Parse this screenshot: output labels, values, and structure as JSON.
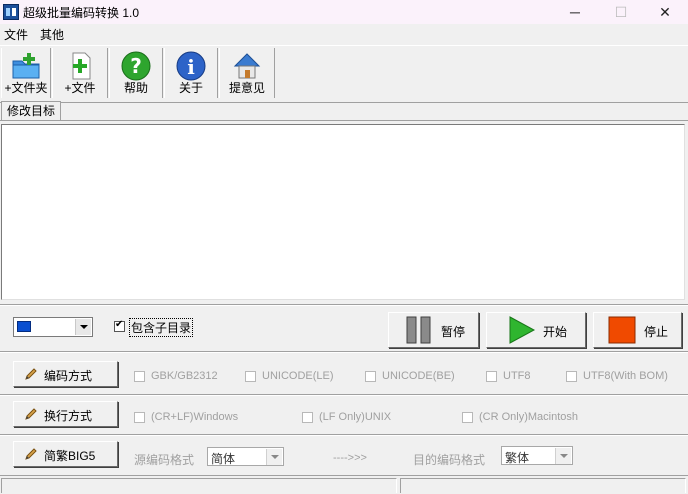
{
  "window": {
    "title": "超级批量编码转换 1.0",
    "minimize_glyph": "─",
    "maximize_glyph": "☐",
    "close_glyph": "✕"
  },
  "menu": {
    "items": [
      "文件",
      "其他"
    ]
  },
  "toolbar": {
    "buttons": [
      {
        "label": "+文件夹",
        "icon": "add-folder-icon"
      },
      {
        "label": "+文件",
        "icon": "add-file-icon"
      },
      {
        "label": "帮助",
        "icon": "help-icon"
      },
      {
        "label": "关于",
        "icon": "info-icon"
      },
      {
        "label": "提意见",
        "icon": "home-feedback-icon"
      }
    ]
  },
  "tabs": {
    "active": "修改目标"
  },
  "controls": {
    "include_subdirs_label": "包含子目录",
    "include_subdirs_checked": true,
    "pause_label": "暂停",
    "start_label": "开始",
    "stop_label": "停止"
  },
  "encoding": {
    "button_label": "编码方式",
    "options": [
      "GBK/GB2312",
      "UNICODE(LE)",
      "UNICODE(BE)",
      "UTF8",
      "UTF8(With BOM)"
    ]
  },
  "linebreak": {
    "button_label": "换行方式",
    "options": [
      "(CR+LF)Windows",
      "(LF Only)UNIX",
      "(CR Only)Macintosh"
    ]
  },
  "big5": {
    "button_label": "简繁BIG5",
    "source_label": "源编码格式",
    "source_value": "简体",
    "arrow": "---->>>",
    "target_label": "目的编码格式",
    "target_value": "繁体"
  },
  "colors": {
    "start_green": "#2fb52f",
    "stop_red": "#f04a00",
    "pause_gray": "#707070",
    "title_bar_bg": "#fbf2fb"
  }
}
